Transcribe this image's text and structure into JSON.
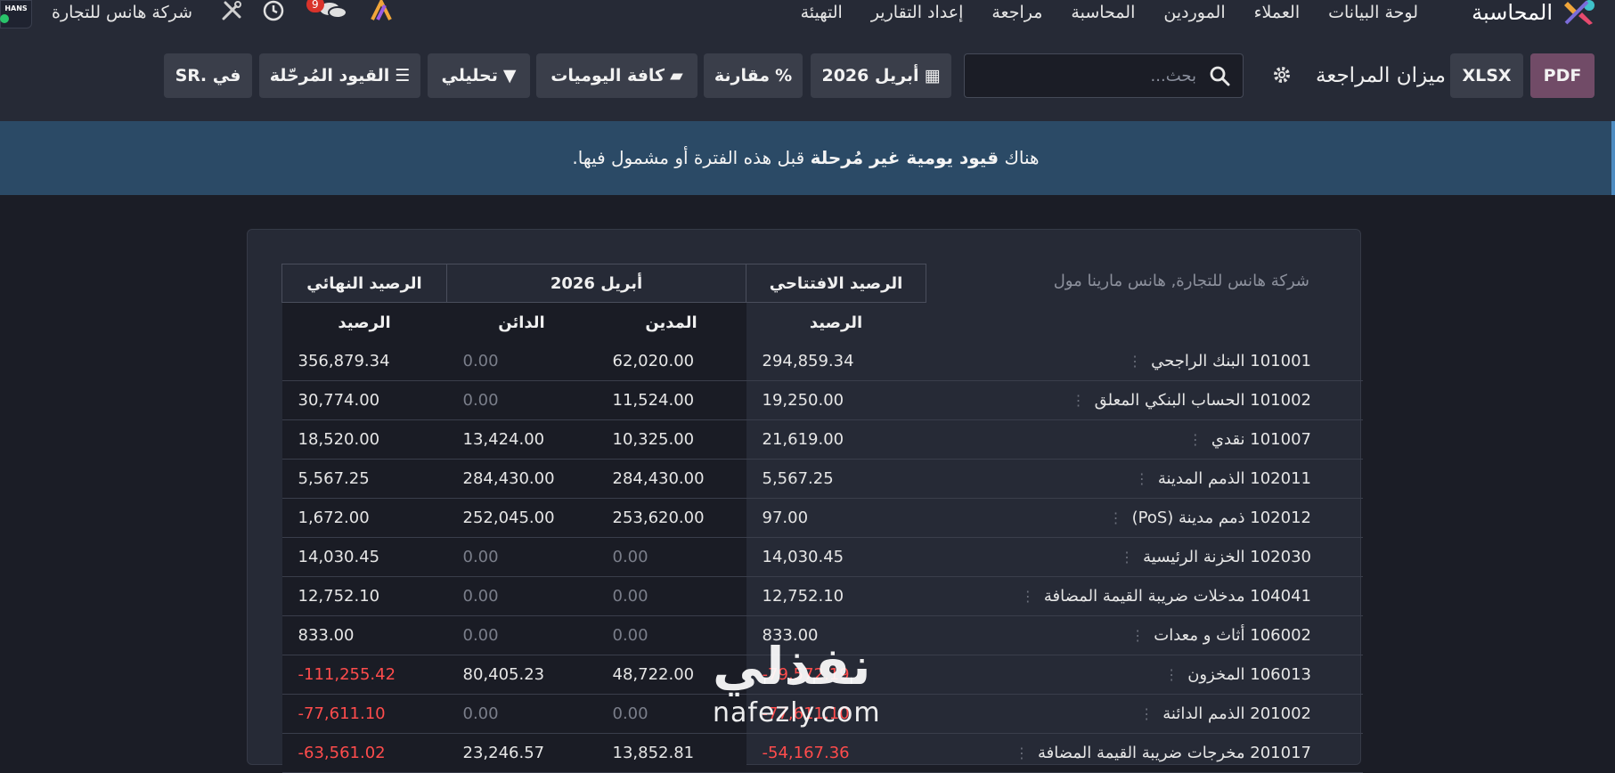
{
  "navbar": {
    "app_name": "المحاسبة",
    "menu": [
      "لوحة البيانات",
      "العملاء",
      "الموردين",
      "المحاسبة",
      "مراجعة",
      "إعداد التقارير",
      "التهيئة"
    ],
    "chat_count": "9",
    "company": "شركة هانس للتجارة",
    "logo_text": "HANS",
    "icons": [
      "brand-logo-icon",
      "app-switch-icon",
      "chat-icon",
      "clock-icon",
      "tools-icon"
    ]
  },
  "control_panel": {
    "pdf_label": "PDF",
    "xlsx_label": "XLSX",
    "report_title": "ميزان المراجعة",
    "search_placeholder": "بحث...",
    "period_label": "أبريل 2026",
    "compare_label": "مقارنة",
    "journals_label": "كافة اليوميات",
    "analytic_label": "تحليلي",
    "adjusting_label": "القيود المُرحّلة",
    "currency_label": "في .SR"
  },
  "alert": {
    "prefix": "هناك",
    "bold": "قيود يومية غير مُرحلة",
    "suffix": "قبل هذه الفترة أو مشمول فيها."
  },
  "report": {
    "company_caption": "شركة هانس للتجارة, هانس مارينا مول",
    "group_headers": {
      "opening": "الرصيد الافتتاحي",
      "period": "أبريل 2026",
      "ending": "الرصيد النهائي"
    },
    "sub_headers": {
      "balance": "الرصيد",
      "debit": "المدين",
      "credit": "الدائن",
      "ending_balance": "الرصيد"
    },
    "rows": [
      {
        "account": "101001 البنك الراجحي",
        "opening": "294,859.34",
        "debit": "62,020.00",
        "credit": "0.00",
        "ending": "356,879.34"
      },
      {
        "account": "101002 الحساب البنكي المعلق",
        "opening": "19,250.00",
        "debit": "11,524.00",
        "credit": "0.00",
        "ending": "30,774.00"
      },
      {
        "account": "101007 نقدي",
        "opening": "21,619.00",
        "debit": "10,325.00",
        "credit": "13,424.00",
        "ending": "18,520.00"
      },
      {
        "account": "102011 الذمم المدينة",
        "opening": "5,567.25",
        "debit": "284,430.00",
        "credit": "284,430.00",
        "ending": "5,567.25"
      },
      {
        "account": "102012 ذمم مدينة (PoS)",
        "opening": "97.00",
        "debit": "253,620.00",
        "credit": "252,045.00",
        "ending": "1,672.00"
      },
      {
        "account": "102030 الخزنة الرئيسية",
        "opening": "14,030.45",
        "debit": "0.00",
        "credit": "0.00",
        "ending": "14,030.45"
      },
      {
        "account": "104041 مدخلات ضريبة القيمة المضافة",
        "opening": "12,752.10",
        "debit": "0.00",
        "credit": "0.00",
        "ending": "12,752.10"
      },
      {
        "account": "106002 أثاث و معدات",
        "opening": "833.00",
        "debit": "0.00",
        "credit": "0.00",
        "ending": "833.00"
      },
      {
        "account": "106013 المخزون",
        "opening": "79,572.19-",
        "debit": "48,722.00",
        "credit": "80,405.23",
        "ending": "111,255.42-"
      },
      {
        "account": "201002 الذمم الدائنة",
        "opening": "77,611.10-",
        "debit": "0.00",
        "credit": "0.00",
        "ending": "77,611.10-"
      },
      {
        "account": "201017 مخرجات ضريبة القيمة المضافة",
        "opening": "54,167.36-",
        "debit": "13,852.81",
        "credit": "23,246.57",
        "ending": "63,561.02-"
      }
    ]
  },
  "watermark": {
    "arabic": "نفذلي",
    "latin": "nafezly.com"
  }
}
